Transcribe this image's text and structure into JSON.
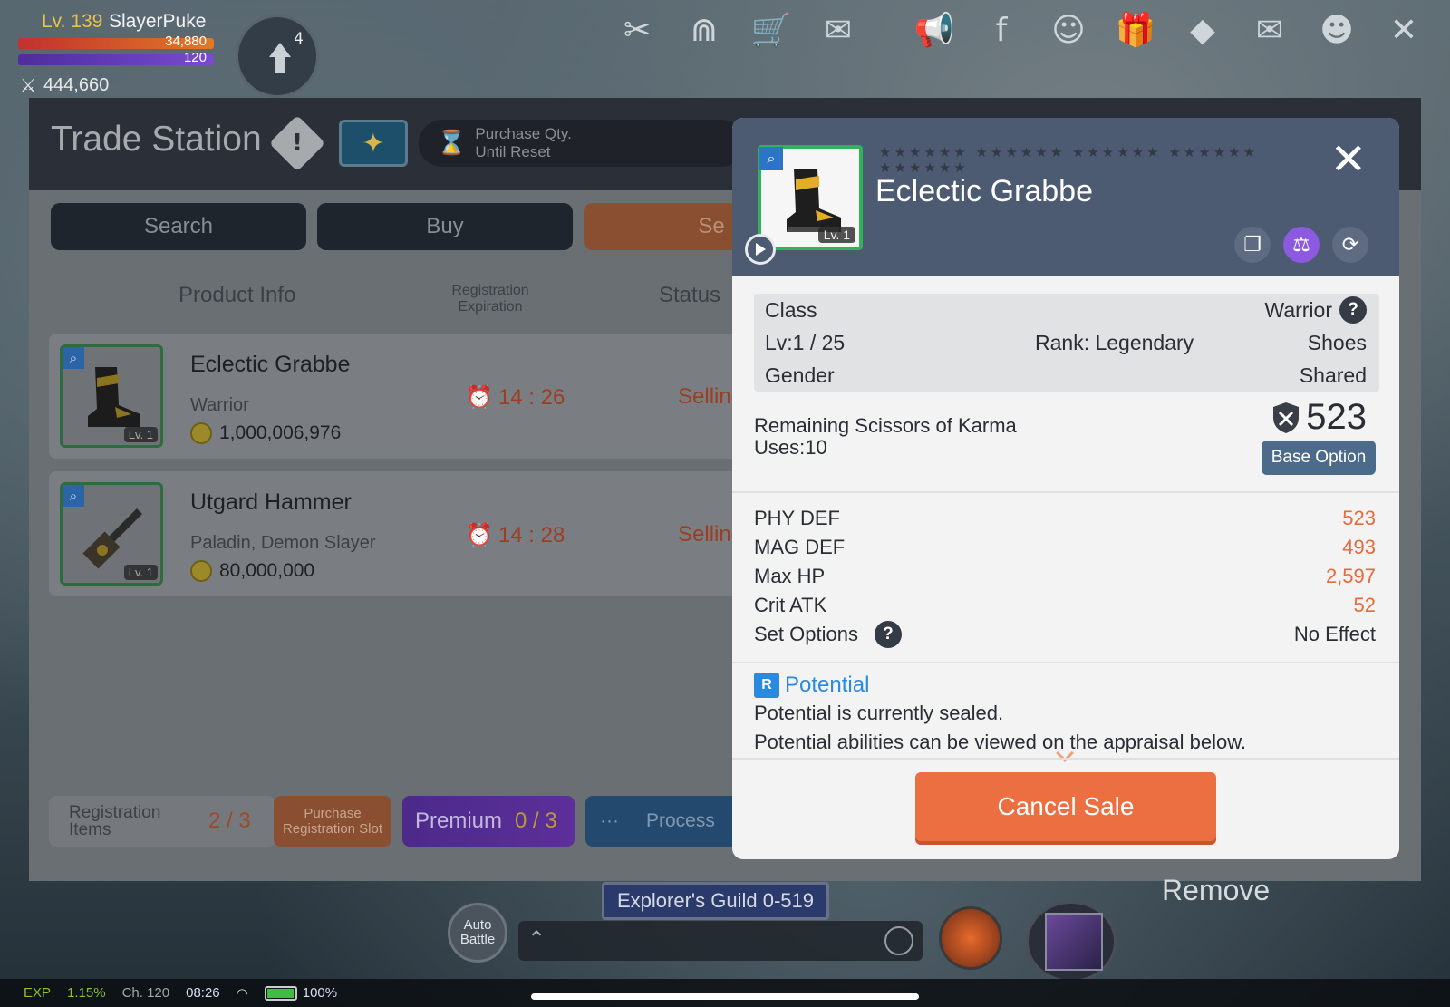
{
  "hud": {
    "level": "Lv. 139",
    "player_name": "SlayerPuke",
    "hp": "34,880",
    "mp": "120",
    "combat_power": "444,660",
    "quest_badge": "4"
  },
  "trade": {
    "title": "Trade Station",
    "purchase_qty": "Purchase Qty. Until Reset",
    "tabs": {
      "search": "Search",
      "buy": "Buy",
      "sell": "Se"
    },
    "columns": {
      "product": "Product Info",
      "registration": "Registration Expiration",
      "status": "Status"
    },
    "rows": [
      {
        "name": "Eclectic Grabbe",
        "class": "Warrior",
        "price": "1,000,006,976",
        "time": "14 : 26",
        "status": "Selling",
        "level": "Lv. 1"
      },
      {
        "name": "Utgard Hammer",
        "class": "Paladin, Demon Slayer",
        "price": "80,000,000",
        "time": "14 : 28",
        "status": "Selling",
        "level": "Lv. 1"
      }
    ],
    "footer": {
      "registration_label": "Registration Items",
      "registration_count": "2 / 3",
      "purchase_slot": "Purchase Registration Slot",
      "premium_label": "Premium",
      "premium_count": "0 / 3",
      "process_label": "Process",
      "process_dots": "···"
    }
  },
  "modal": {
    "stars": "★★★★★★ ★★★★★★ ★★★★★★ ★★★★★★ ★★★★★★",
    "title": "Eclectic Grabbe",
    "thumb_level": "Lv. 1",
    "class_label": "Class",
    "class_value": "Warrior",
    "level_label": "Lv:1 / 25",
    "rank": "Rank: Legendary",
    "type": "Shoes",
    "gender_label": "Gender",
    "gender_value": "Shared",
    "karma_line1": "Remaining Scissors of Karma",
    "karma_line2": "Uses:10",
    "score": "523",
    "base_option": "Base Option",
    "stats": [
      {
        "name": "PHY DEF",
        "value": "523"
      },
      {
        "name": "MAG DEF",
        "value": "493"
      },
      {
        "name": "Max HP",
        "value": "2,597"
      },
      {
        "name": "Crit ATK",
        "value": "52"
      },
      {
        "name": "Set Options",
        "value": "No Effect"
      }
    ],
    "potential_badge": "R",
    "potential_title": "Potential",
    "potential_line1": "Potential is currently sealed.",
    "potential_line2": "Potential abilities can be viewed on the appraisal below.",
    "cancel": "Cancel Sale"
  },
  "bottom": {
    "guild": "Explorer's Guild 0-519",
    "auto_battle": "Auto Battle",
    "remove": "Remove",
    "exp_label": "EXP",
    "exp_value": "1.15%",
    "channel": "Ch. 120",
    "clock": "08:26",
    "battery": "100%"
  },
  "colors": {
    "accent": "#ec6f42",
    "modal_header": "#4c5a72",
    "stat_value": "#e86a3a",
    "potential": "#2a8ae0"
  }
}
